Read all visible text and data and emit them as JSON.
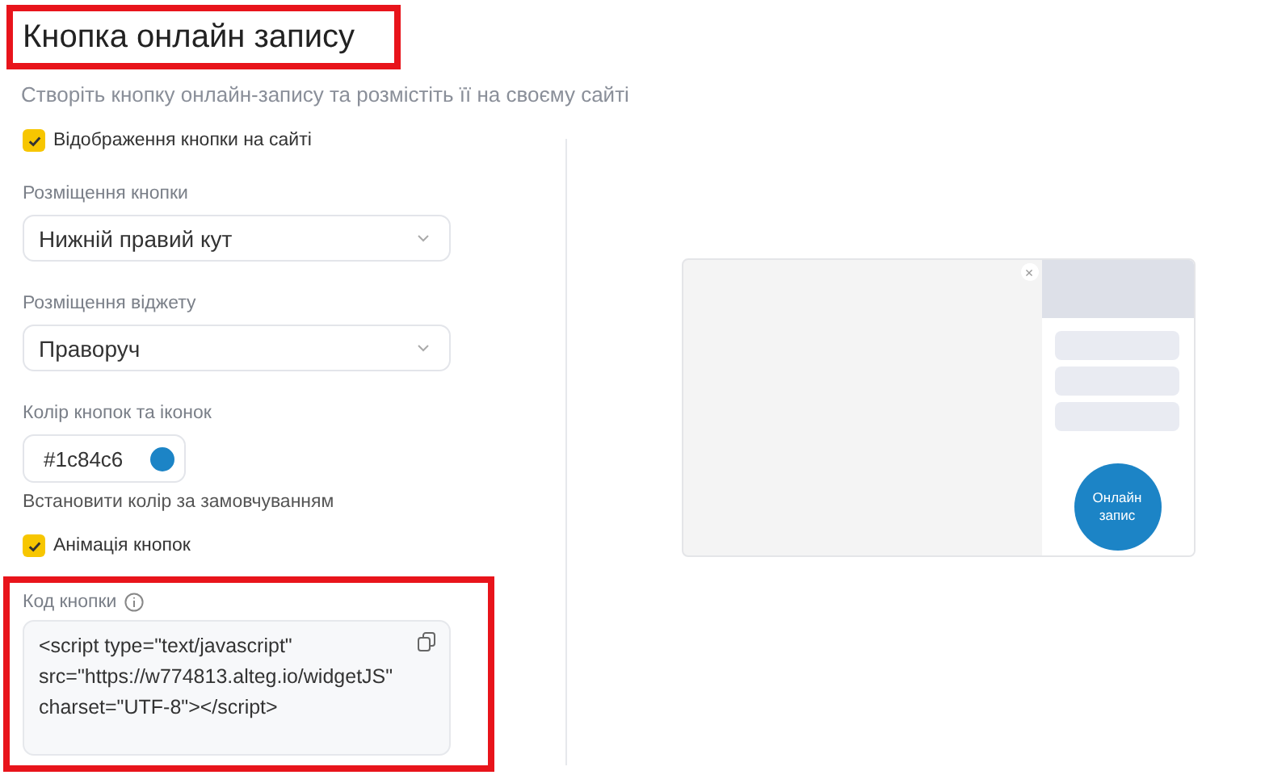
{
  "title": {
    "text": "Кнопка онлайн запису",
    "highlighted": true
  },
  "subtitle": "Створіть кнопку онлайн-запису та розмістіть її на своєму сайті",
  "show_on_site": {
    "label": "Відображення кнопки на сайті",
    "checked": true
  },
  "button_position": {
    "label": "Розміщення кнопки",
    "value": "Нижній правий кут"
  },
  "widget_position": {
    "label": "Розміщення віджету",
    "value": "Праворуч"
  },
  "color": {
    "label": "Колір кнопок та іконок",
    "value": "#1c84c6",
    "color": "#1c84c6"
  },
  "reset_color": "Встановити колір за замовчуванням",
  "animation": {
    "label": "Анімація кнопок",
    "checked": true
  },
  "code": {
    "label": "Код кнопки",
    "value": "<script type=\"text/javascript\" src=\"https://w774813.alteg.io/widgetJS\" charset=\"UTF-8\"></script>",
    "highlighted": true
  },
  "preview": {
    "button_text": "Онлайн запис",
    "close": "×"
  }
}
